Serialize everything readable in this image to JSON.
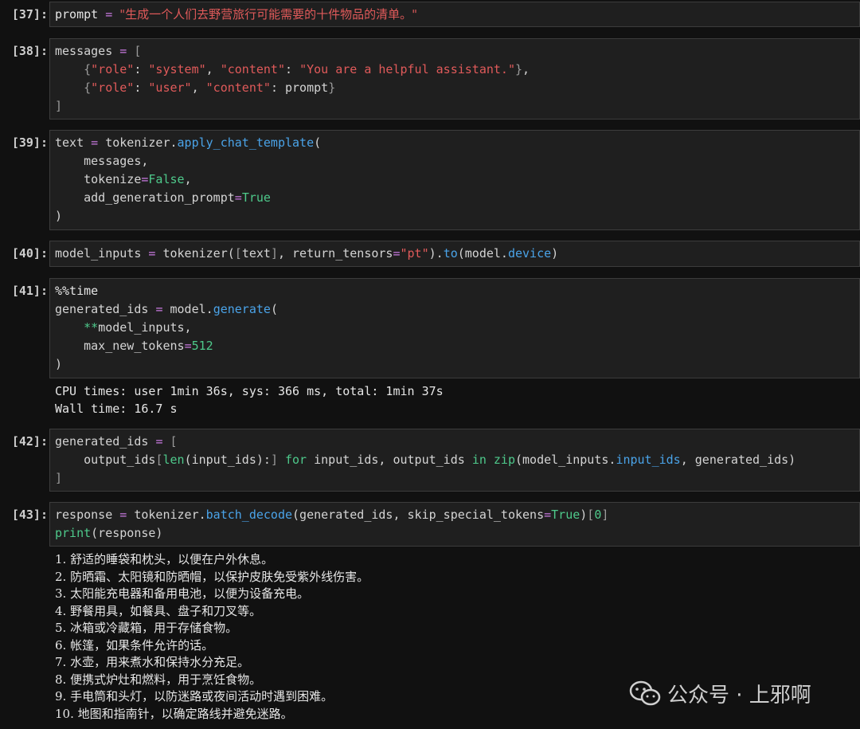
{
  "cells": [
    {
      "n": "[37]:",
      "lines": [
        "prompt = \"生成一个人们去野营旅行可能需要的十件物品的清单。\""
      ]
    },
    {
      "n": "[38]:",
      "lines": [
        "messages = [",
        "    {\"role\": \"system\", \"content\": \"You are a helpful assistant.\"},",
        "    {\"role\": \"user\", \"content\": prompt}",
        "]"
      ]
    },
    {
      "n": "[39]:",
      "lines": [
        "text = tokenizer.apply_chat_template(",
        "    messages,",
        "    tokenize=False,",
        "    add_generation_prompt=True",
        ")"
      ]
    },
    {
      "n": "[40]:",
      "lines": [
        "model_inputs = tokenizer([text], return_tensors=\"pt\").to(model.device)"
      ]
    },
    {
      "n": "[41]:",
      "lines": [
        "%%time",
        "generated_ids = model.generate(",
        "    **model_inputs,",
        "    max_new_tokens=512",
        ")"
      ],
      "output": [
        "CPU times: user 1min 36s, sys: 366 ms, total: 1min 37s",
        "Wall time: 16.7 s"
      ]
    },
    {
      "n": "[42]:",
      "lines": [
        "generated_ids = [",
        "    output_ids[len(input_ids):] for input_ids, output_ids in zip(model_inputs.input_ids, generated_ids)",
        "]"
      ]
    },
    {
      "n": "[43]:",
      "lines": [
        "response = tokenizer.batch_decode(generated_ids, skip_special_tokens=True)[0]",
        "print(response)"
      ],
      "output": [
        "1. 舒适的睡袋和枕头，以便在户外休息。",
        "2. 防晒霜、太阳镜和防晒帽，以保护皮肤免受紫外线伤害。",
        "3. 太阳能充电器和备用电池，以便为设备充电。",
        "4. 野餐用具，如餐具、盘子和刀叉等。",
        "5. 冰箱或冷藏箱，用于存储食物。",
        "6. 帐篷，如果条件允许的话。",
        "7. 水壶，用来煮水和保持水分充足。",
        "8. 便携式炉灶和燃料，用于烹饪食物。",
        "9. 手电筒和头灯，以防迷路或夜间活动时遇到困难。",
        "10. 地图和指南针，以确定路线并避免迷路。"
      ]
    }
  ],
  "watermark": {
    "text": "公众号 · 上邪啊",
    "icon": "wechat-icon"
  }
}
